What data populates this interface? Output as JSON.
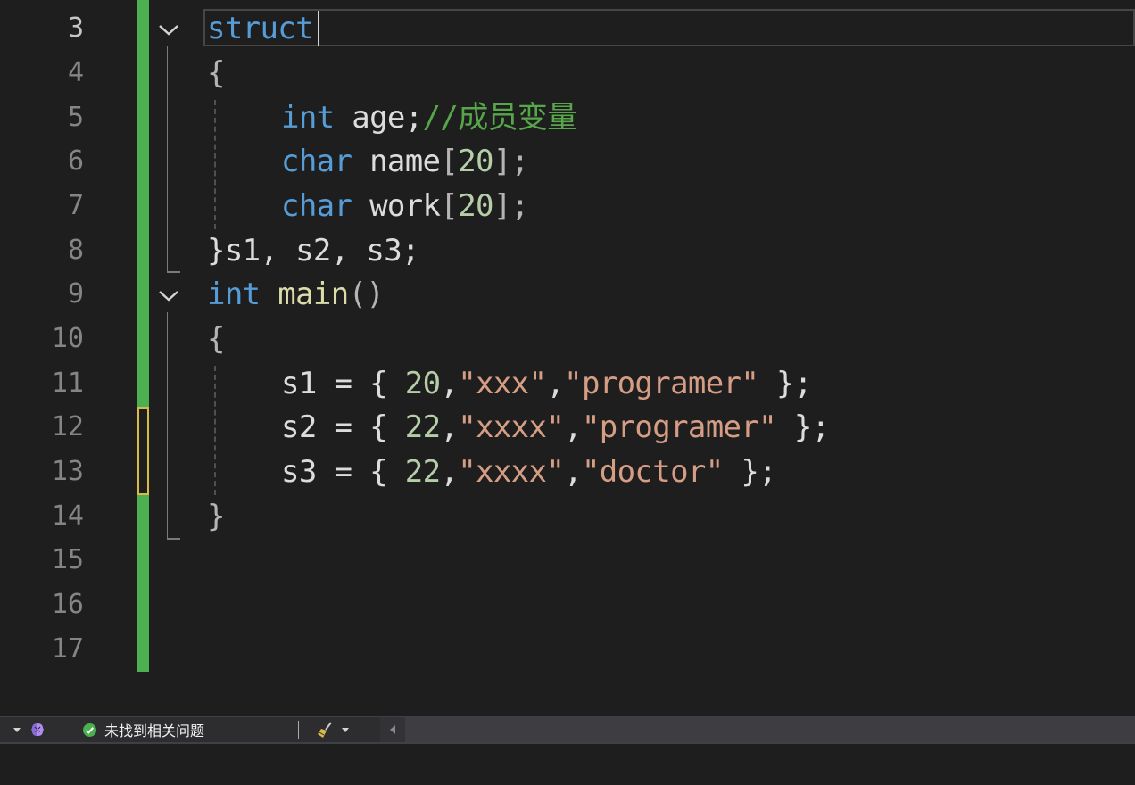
{
  "editor": {
    "line_numbers": [
      "3",
      "4",
      "5",
      "6",
      "7",
      "8",
      "9",
      "10",
      "11",
      "12",
      "13",
      "14",
      "15",
      "16",
      "17"
    ],
    "tokens": {
      "l3_struct": "struct",
      "l4_brace": "{",
      "l5_type": "int",
      "l5_rest": " age;",
      "l5_comment": "//成员变量",
      "l6_type": "char",
      "l6_name": " name",
      "l6_open": "[",
      "l6_num": "20",
      "l6_close": "];",
      "l7_type": "char",
      "l7_name": " work",
      "l7_open": "[",
      "l7_num": "20",
      "l7_close": "];",
      "l8_text": "}s1, s2, s3;",
      "l9_type": "int",
      "l9_fn": "main",
      "l9_parens": "()",
      "l10_brace": "{",
      "l11_a": "s1 = { ",
      "l11_num": "20",
      "l11_c1": ",",
      "l11_s1": "\"xxx\"",
      "l11_c2": ",",
      "l11_s2": "\"programer\"",
      "l11_end": " };",
      "l12_a": "s2 = { ",
      "l12_num": "22",
      "l12_c1": ",",
      "l12_s1": "\"xxxx\"",
      "l12_c2": ",",
      "l12_s2": "\"programer\"",
      "l12_end": " };",
      "l13_a": "s3 = { ",
      "l13_num": "22",
      "l13_c1": ",",
      "l13_s1": "\"xxxx\"",
      "l13_c2": ",",
      "l13_s2": "\"doctor\"",
      "l13_end": " };",
      "l14_brace": "}"
    }
  },
  "statusbar": {
    "issues_text": "未找到相关问题"
  },
  "colors": {
    "keyword": "#569cd6",
    "function": "#dcdcaa",
    "number": "#b5cea8",
    "string": "#d69d85",
    "comment": "#57a64a",
    "change_saved": "#4caf50",
    "change_unsaved": "#d7ba4a"
  },
  "icons": [
    "chevron-down-icon",
    "brain-icon",
    "check-circle-icon",
    "broom-icon",
    "scroll-left-icon"
  ]
}
